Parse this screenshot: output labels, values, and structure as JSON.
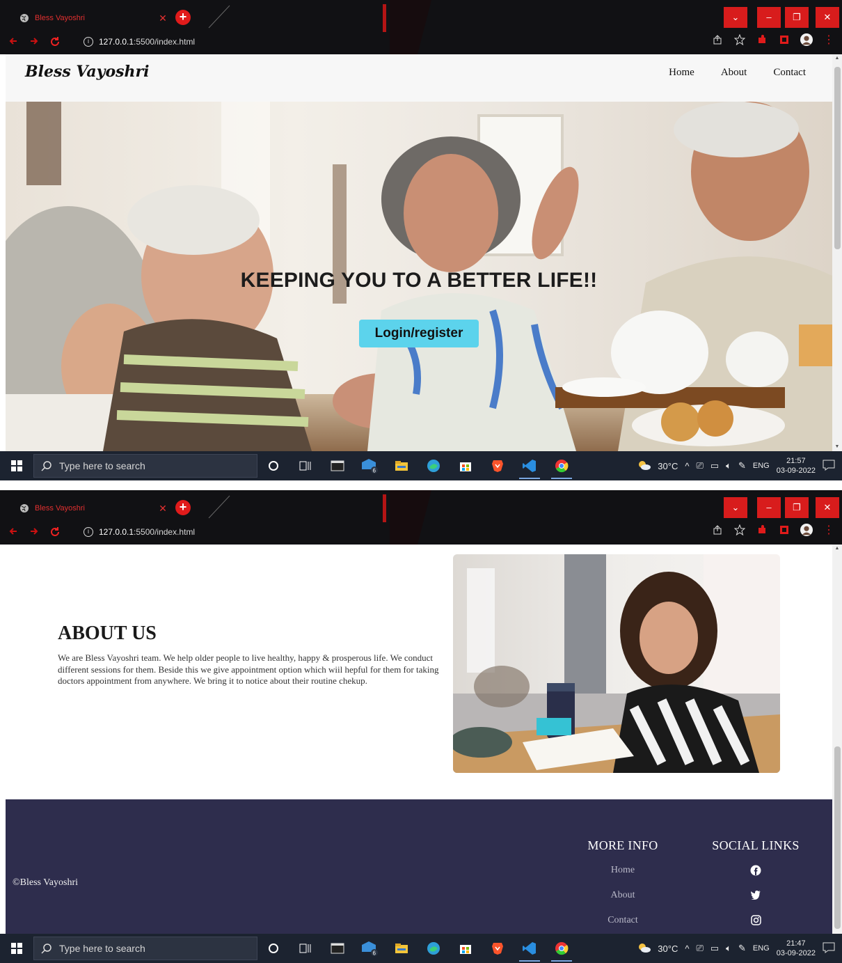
{
  "browser": {
    "tab_title": "Bless Vayoshri",
    "url_host": "127.0.0.1",
    "url_rest": ":5500/index.html"
  },
  "site": {
    "brand": "Bless Vayoshri",
    "nav": [
      "Home",
      "About",
      "Contact"
    ],
    "hero": {
      "title": "KEEPING YOU TO A BETTER LIFE!!",
      "button": "Login/register"
    },
    "about": {
      "heading": "ABOUT US",
      "text": "We are Bless Vayoshri team. We help older people to live healthy, happy & prosperous life. We conduct different sessions for them. Beside this we give appointment option which wiil hepful for them for taking doctors appointment from anywhere. We bring it to notice about their routine chekup."
    },
    "footer": {
      "copyright": "©Bless Vayoshri",
      "more_info": {
        "heading": "MORE INFO",
        "links": [
          "Home",
          "About",
          "Contact"
        ]
      },
      "social": {
        "heading": "SOCIAL LINKS",
        "icons": [
          "facebook-icon",
          "twitter-icon",
          "instagram-icon"
        ]
      }
    }
  },
  "taskbar": {
    "search_placeholder": "Type here to search",
    "weather": "30°C",
    "lang": "ENG",
    "shot1": {
      "time": "21:57",
      "date": "03-09-2022"
    },
    "shot2": {
      "time": "21:47",
      "date": "03-09-2022"
    },
    "mail_badge": "6"
  },
  "colors": {
    "browser_bg": "#111114",
    "accent_red": "#d81c1c",
    "hero_button": "#5cd3ec",
    "footer_bg": "#2e2d4d",
    "taskbar_bg": "#1c2330"
  }
}
